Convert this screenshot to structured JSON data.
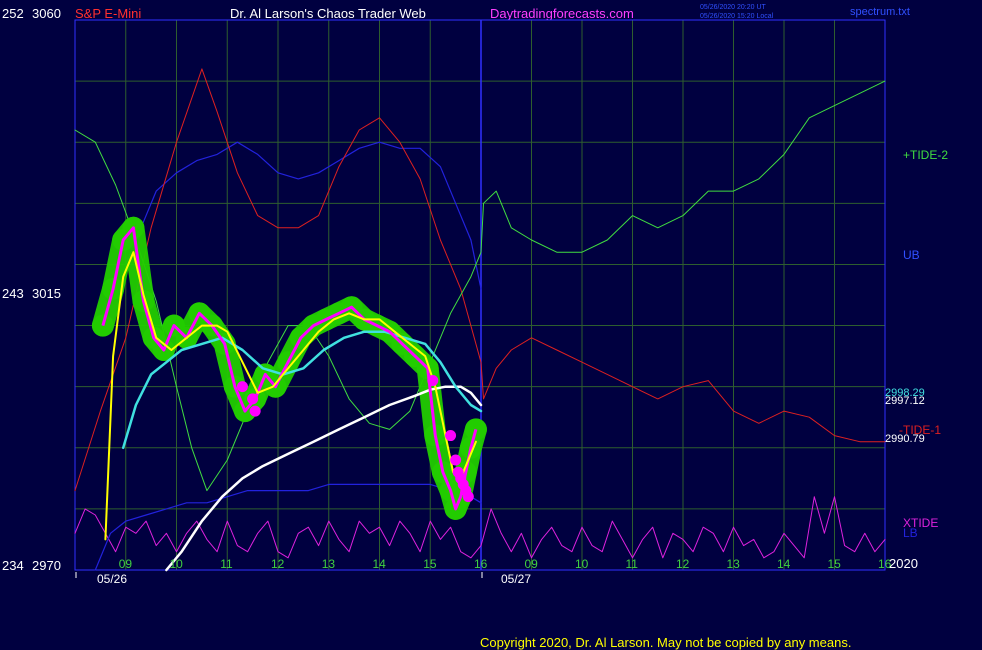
{
  "header": {
    "instrument": "S&P E-Mini",
    "title": "Dr. Al Larson's Chaos Trader Web",
    "site": "Daytradingforecasts.com",
    "time_ut": "05/26/2020 20:20 UT",
    "time_local": "05/26/2020 15:20 Local",
    "spectrum": "spectrum.txt"
  },
  "axis": {
    "left_labels": [
      {
        "lunar": "252",
        "price": "3060",
        "y_price": 3060
      },
      {
        "lunar": "243",
        "price": "3015",
        "y_price": 3015
      },
      {
        "lunar": "234",
        "price": "2970",
        "y_price": 2970
      }
    ],
    "hour_ticks_day1": [
      "09",
      "10",
      "11",
      "12",
      "13",
      "14",
      "15",
      "16"
    ],
    "hour_ticks_day2": [
      "09",
      "10",
      "11",
      "12",
      "13",
      "14",
      "15",
      "16"
    ],
    "dates": [
      "05/26",
      "05/27"
    ],
    "year_label": "2020"
  },
  "right_labels": {
    "tide2": "+TIDE-2",
    "ub": "UB",
    "price_a": "2998.29",
    "price_b": "2997.12",
    "tide1": "-TIDE-1",
    "price_c": "2990.79",
    "xtide": "XTIDE",
    "lb": "LB"
  },
  "footer": {
    "copyright": "Copyright 2020, Dr. Al Larson. May not be copied by any means."
  },
  "colors": {
    "background": "#000040",
    "plot_border": "#3030ff",
    "grid": "#2e5e2e",
    "price": "#ff00ff",
    "price_glow": "#22cc00",
    "yellow_ma": "#ffff00",
    "cyan_ma": "#40e0e0",
    "white_ma": "#ffffff",
    "tide1": "#dd2020",
    "tide2": "#40dd40",
    "bands": "#2222dd",
    "xtide": "#dd22dd",
    "title_red": "#ff3030",
    "title_white": "#ffffff",
    "site_magenta": "#ff40ff",
    "axis_green": "#40d040",
    "axis_white": "#ffffff",
    "blue_text": "#3050ff"
  },
  "chart_data": {
    "type": "line",
    "title": "S&P E-Mini",
    "ylim": [
      2970,
      3060
    ],
    "x_unit": "hour (day 1: 05/26 09–16, day 2: 05/27 09–16)",
    "series": [
      {
        "name": "price",
        "x": [
          8.55,
          8.75,
          8.95,
          9.15,
          9.35,
          9.55,
          9.75,
          9.95,
          10.2,
          10.45,
          10.7,
          10.95,
          11.15,
          11.35,
          11.55,
          11.75,
          11.95,
          12.2,
          12.45,
          12.7,
          12.95,
          13.2,
          13.45,
          13.7,
          13.95,
          14.2,
          14.45,
          14.7,
          14.95,
          15.1,
          15.25,
          15.4,
          15.5,
          15.6,
          15.7,
          15.8,
          15.9
        ],
        "y": [
          3010,
          3016,
          3024,
          3026,
          3014,
          3008,
          3006,
          3010,
          3008,
          3012,
          3010,
          3007,
          3000,
          2996,
          2998,
          3002,
          3000,
          3004,
          3008,
          3010,
          3011,
          3012,
          3013,
          3011,
          3010,
          3009,
          3007,
          3005,
          3003,
          2992,
          2986,
          2983,
          2980,
          2982,
          2986,
          2990,
          2993
        ]
      },
      {
        "name": "yellow_ma",
        "x": [
          8.6,
          8.75,
          8.95,
          9.15,
          9.35,
          9.6,
          9.9,
          10.2,
          10.5,
          10.8,
          11.0,
          11.3,
          11.6,
          11.9,
          12.2,
          12.5,
          12.8,
          13.1,
          13.4,
          13.7,
          14.0,
          14.3,
          14.6,
          14.9,
          15.1,
          15.3,
          15.45,
          15.6,
          15.75,
          15.9
        ],
        "y": [
          2975,
          3005,
          3018,
          3022,
          3015,
          3008,
          3006,
          3008,
          3010,
          3010,
          3009,
          3004,
          2999,
          3000,
          3003,
          3006,
          3009,
          3011,
          3012,
          3011,
          3011,
          3009,
          3007,
          3005,
          3000,
          2992,
          2986,
          2985,
          2988,
          2991
        ]
      },
      {
        "name": "cyan_ma",
        "x": [
          8.95,
          9.2,
          9.5,
          9.8,
          10.1,
          10.5,
          10.9,
          11.3,
          11.7,
          12.1,
          12.5,
          12.9,
          13.3,
          13.7,
          14.1,
          14.5,
          14.9,
          15.2,
          15.5,
          15.8,
          16.0
        ],
        "y": [
          2990,
          2997,
          3002,
          3004,
          3006,
          3007,
          3008,
          3006,
          3003,
          3002,
          3003,
          3006,
          3008,
          3009,
          3009,
          3008,
          3007,
          3004,
          3000,
          2997,
          2996
        ]
      },
      {
        "name": "white_ma",
        "x": [
          9.8,
          10.1,
          10.5,
          10.9,
          11.3,
          11.7,
          12.2,
          12.7,
          13.2,
          13.7,
          14.2,
          14.7,
          15.0,
          15.3,
          15.6,
          15.8,
          16.0
        ],
        "y": [
          2970,
          2973,
          2978,
          2982,
          2985,
          2987,
          2989,
          2991,
          2993,
          2995,
          2997,
          2998.5,
          2999.5,
          3000,
          3000,
          2999,
          2997
        ]
      },
      {
        "name": "-TIDE-1",
        "x": [
          8.0,
          8.5,
          9.0,
          9.5,
          10.0,
          10.5,
          10.8,
          11.2,
          11.6,
          12.0,
          12.4,
          12.8,
          13.2,
          13.6,
          14.0,
          14.4,
          14.8,
          15.2,
          15.6,
          16.0,
          16.05,
          16.3,
          16.6,
          17.0,
          17.5,
          18.0,
          18.5,
          19.0,
          19.5,
          20.0,
          20.5,
          21.0,
          21.5,
          22.0,
          22.5,
          23.0,
          23.5,
          24.0
        ],
        "y": [
          2983,
          2996,
          3008,
          3026,
          3040,
          3052,
          3045,
          3035,
          3028,
          3026,
          3026,
          3028,
          3036,
          3042,
          3044,
          3040,
          3034,
          3024,
          3016,
          3004,
          2998,
          3003,
          3006,
          3008,
          3006,
          3004,
          3002,
          3000,
          2998,
          3000,
          3001,
          2996,
          2994,
          2996,
          2995,
          2992,
          2991,
          2991
        ]
      },
      {
        "name": "+TIDE-2",
        "x": [
          8.0,
          8.4,
          8.8,
          9.2,
          9.6,
          10.0,
          10.3,
          10.6,
          11.0,
          11.4,
          11.8,
          12.2,
          12.6,
          13.0,
          13.4,
          13.8,
          14.2,
          14.6,
          15.0,
          15.4,
          15.8,
          16.0,
          16.05,
          16.3,
          16.6,
          17.0,
          17.5,
          18.0,
          18.5,
          19.0,
          19.5,
          20.0,
          20.5,
          21.0,
          21.5,
          22.0,
          22.5,
          23.0,
          23.5,
          24.0
        ],
        "y": [
          3042,
          3040,
          3033,
          3024,
          3014,
          3000,
          2990,
          2983,
          2988,
          2996,
          3004,
          3010,
          3010,
          3005,
          2998,
          2994,
          2993,
          2996,
          3004,
          3012,
          3018,
          3022,
          3030,
          3032,
          3026,
          3024,
          3022,
          3022,
          3024,
          3028,
          3026,
          3028,
          3032,
          3032,
          3034,
          3038,
          3044,
          3046,
          3048,
          3050
        ]
      },
      {
        "name": "UB",
        "x": [
          9.0,
          9.3,
          9.6,
          10.0,
          10.4,
          10.8,
          11.2,
          11.6,
          12.0,
          12.4,
          12.8,
          13.2,
          13.6,
          14.0,
          14.4,
          14.8,
          15.2,
          15.5,
          15.8,
          16.0
        ],
        "y": [
          3020,
          3026,
          3032,
          3035,
          3037,
          3038,
          3040,
          3038,
          3035,
          3034,
          3035,
          3037,
          3039,
          3040,
          3039,
          3039,
          3036,
          3030,
          3024,
          3016
        ]
      },
      {
        "name": "LB",
        "x": [
          8.4,
          8.7,
          9.0,
          9.4,
          9.8,
          10.2,
          10.6,
          11.0,
          11.4,
          11.8,
          12.2,
          12.6,
          13.0,
          13.4,
          13.8,
          14.2,
          14.6,
          15.0,
          15.4,
          15.8,
          16.0
        ],
        "y": [
          2970,
          2976,
          2978,
          2979,
          2980,
          2981,
          2981,
          2982,
          2983,
          2983,
          2983,
          2983,
          2984,
          2984,
          2984,
          2984,
          2984,
          2984,
          2983,
          2982,
          2981
        ]
      },
      {
        "name": "XTIDE",
        "x": [
          8.0,
          8.2,
          8.4,
          8.6,
          8.8,
          9.0,
          9.2,
          9.4,
          9.6,
          9.8,
          10.0,
          10.2,
          10.4,
          10.6,
          10.8,
          11.0,
          11.2,
          11.4,
          11.6,
          11.8,
          12.0,
          12.2,
          12.4,
          12.6,
          12.8,
          13.0,
          13.2,
          13.4,
          13.6,
          13.8,
          14.0,
          14.2,
          14.4,
          14.6,
          14.8,
          15.0,
          15.2,
          15.4,
          15.6,
          15.8,
          16.0,
          16.2,
          16.4,
          16.6,
          16.8,
          17.0,
          17.2,
          17.4,
          17.6,
          17.8,
          18.0,
          18.2,
          18.4,
          18.6,
          18.8,
          19.0,
          19.2,
          19.4,
          19.6,
          19.8,
          20.0,
          20.2,
          20.4,
          20.6,
          20.8,
          21.0,
          21.2,
          21.4,
          21.6,
          21.8,
          22.0,
          22.2,
          22.4,
          22.6,
          22.8,
          23.0,
          23.2,
          23.4,
          23.6,
          23.8,
          24.0
        ],
        "y": [
          2976,
          2980,
          2979,
          2976,
          2973,
          2977,
          2976,
          2978,
          2974,
          2976,
          2973,
          2976,
          2978,
          2975,
          2973,
          2978,
          2974,
          2973,
          2976,
          2978,
          2973,
          2972,
          2976,
          2977,
          2974,
          2978,
          2975,
          2973,
          2978,
          2976,
          2977,
          2974,
          2978,
          2976,
          2973,
          2978,
          2975,
          2977,
          2973,
          2972,
          2974,
          2980,
          2976,
          2973,
          2976,
          2972,
          2975,
          2977,
          2974,
          2973,
          2977,
          2974,
          2973,
          2978,
          2975,
          2972,
          2975,
          2977,
          2972,
          2976,
          2975,
          2973,
          2977,
          2976,
          2973,
          2977,
          2974,
          2975,
          2972,
          2973,
          2976,
          2974,
          2972,
          2982,
          2976,
          2982,
          2974,
          2973,
          2976,
          2973,
          2975
        ]
      }
    ],
    "markers": {
      "name": "pivot_points",
      "x": [
        11.3,
        11.5,
        11.55,
        15.05,
        15.4,
        15.5,
        15.55,
        15.6,
        15.65,
        15.7,
        15.75
      ],
      "y": [
        3000,
        2998,
        2996,
        3001,
        2992,
        2988,
        2986,
        2985,
        2984,
        2983,
        2982
      ]
    }
  }
}
